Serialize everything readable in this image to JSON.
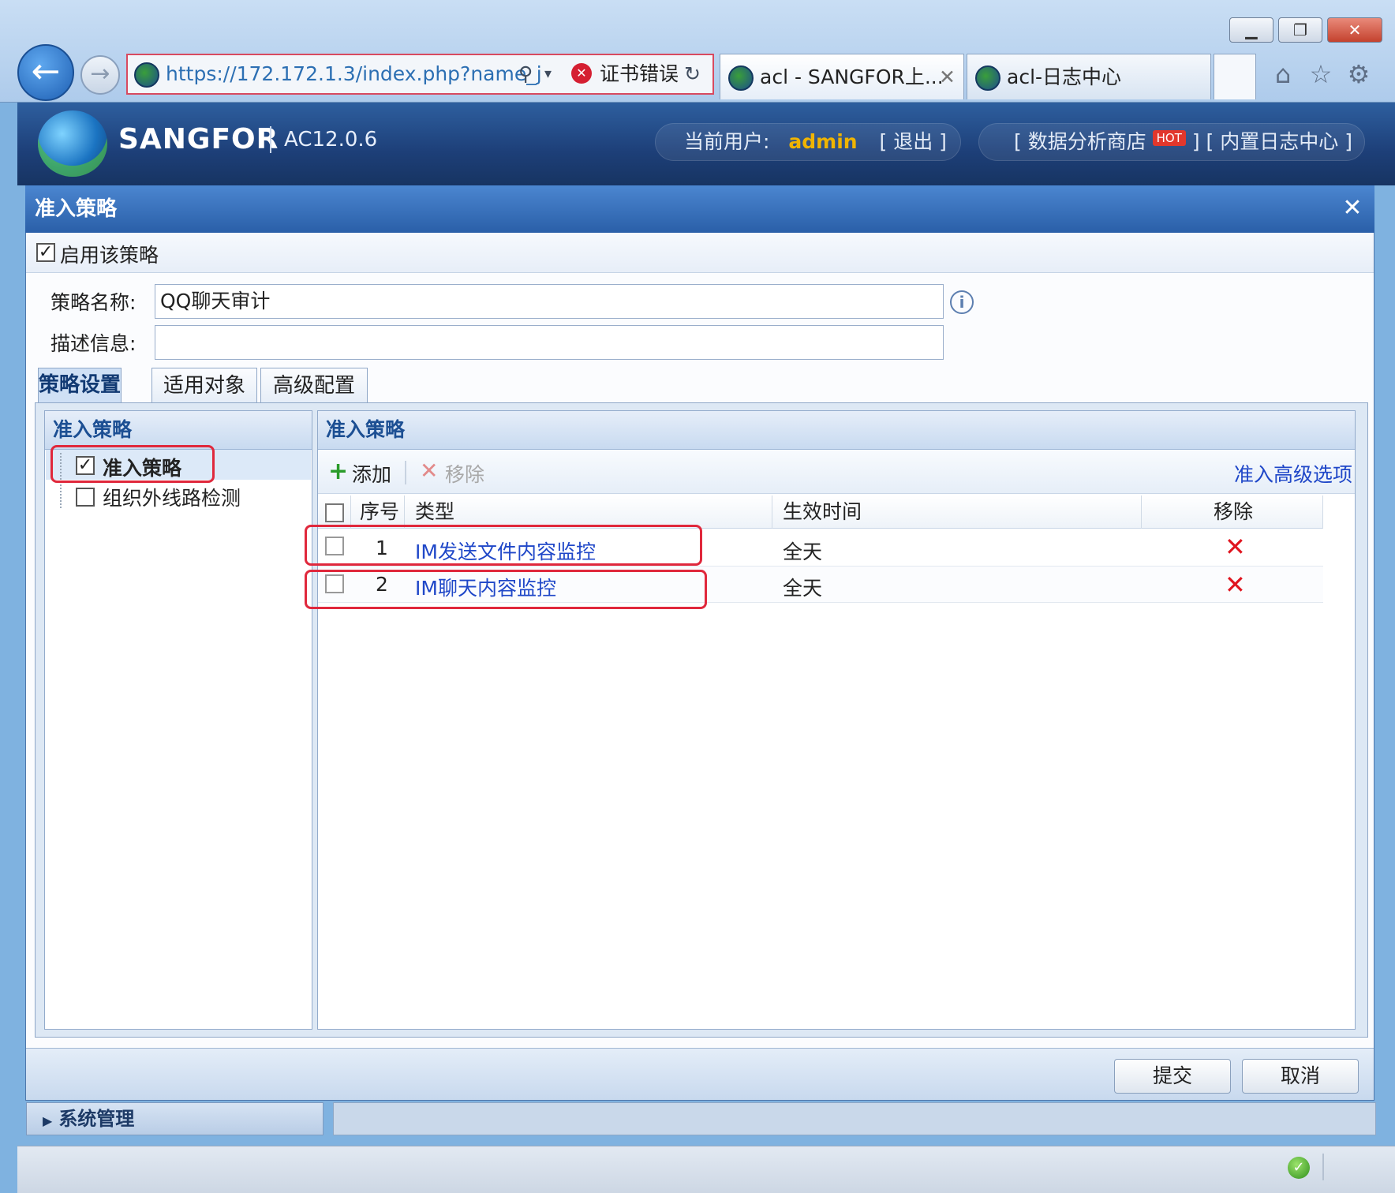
{
  "browser": {
    "url": "https://172.172.1.3/index.php?name_j",
    "cert_error": "证书错误",
    "tabs": [
      {
        "label": "acl - SANGFOR上..."
      },
      {
        "label": "acl-日志中心"
      }
    ]
  },
  "header": {
    "brand": "SANGFOR",
    "version": "AC12.0.6",
    "user_prefix": "当前用户:",
    "user": "admin",
    "logout": "[ 退出 ]",
    "store": "[ 数据分析商店",
    "hot": "HOT",
    "log_center": "] [ 内置日志中心 ]"
  },
  "dialog": {
    "title": "准入策略",
    "enable_label": "启用该策略",
    "name_label": "策略名称:",
    "name_value": "QQ聊天审计",
    "desc_label": "描述信息:",
    "desc_value": "",
    "tabs": [
      "策略设置",
      "适用对象",
      "高级配置"
    ],
    "left_panel": {
      "title": "准入策略",
      "items": [
        {
          "label": "准入策略",
          "checked": true
        },
        {
          "label": "组织外线路检测",
          "checked": false
        }
      ]
    },
    "right_panel": {
      "title": "准入策略",
      "add": "添加",
      "remove": "移除",
      "advanced": "准入高级选项",
      "columns": [
        "序号",
        "类型",
        "生效时间",
        "移除"
      ],
      "rows": [
        {
          "index": "1",
          "type": "IM发送文件内容监控",
          "time": "全天"
        },
        {
          "index": "2",
          "type": "IM聊天内容监控",
          "time": "全天"
        }
      ]
    },
    "submit": "提交",
    "cancel": "取消"
  },
  "sidebar_bottom": {
    "label": "系统管理"
  },
  "colors": {
    "accent": "#2a5fa8",
    "link": "#1f47c8",
    "highlight": "#e0283c",
    "admin": "#f0b400"
  }
}
